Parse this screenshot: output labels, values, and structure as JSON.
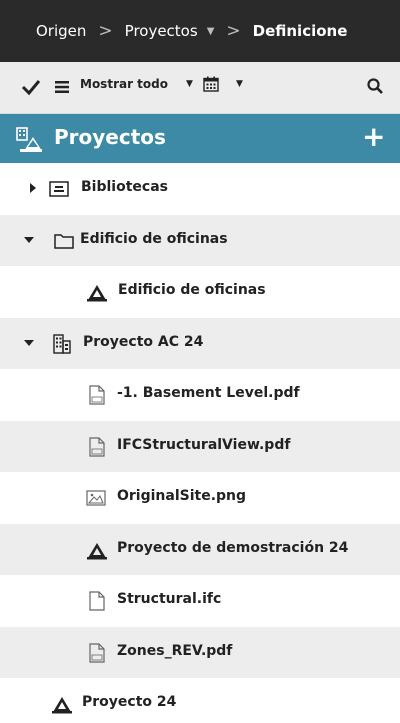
{
  "breadcrumb": {
    "items": [
      "Origen",
      "Proyectos",
      "Definicione"
    ],
    "separator": ">"
  },
  "toolbar": {
    "show_all_label": "Mostrar todo"
  },
  "panel": {
    "title": "Proyectos",
    "add_label": "+",
    "header_color": "#3c8aa6"
  },
  "tree": {
    "items": [
      {
        "label": "Bibliotecas",
        "icon": "library-box-icon",
        "expander": "collapsed"
      },
      {
        "label": "Edificio de oficinas",
        "icon": "folder-icon",
        "expander": "expanded"
      },
      {
        "label": "Edificio de oficinas",
        "icon": "building-model-icon"
      },
      {
        "label": "Proyecto AC 24",
        "icon": "office-building-icon",
        "expander": "expanded"
      },
      {
        "label": "-1. Basement Level.pdf",
        "icon": "pdf-file-icon"
      },
      {
        "label": "IFCStructuralView.pdf",
        "icon": "pdf-file-icon"
      },
      {
        "label": "OriginalSite.png",
        "icon": "image-file-icon"
      },
      {
        "label": "Proyecto de demostración 24",
        "icon": "building-model-icon"
      },
      {
        "label": "Structural.ifc",
        "icon": "file-icon"
      },
      {
        "label": "Zones_REV.pdf",
        "icon": "pdf-file-icon"
      },
      {
        "label": "Proyecto 24",
        "icon": "building-model-icon"
      }
    ]
  }
}
